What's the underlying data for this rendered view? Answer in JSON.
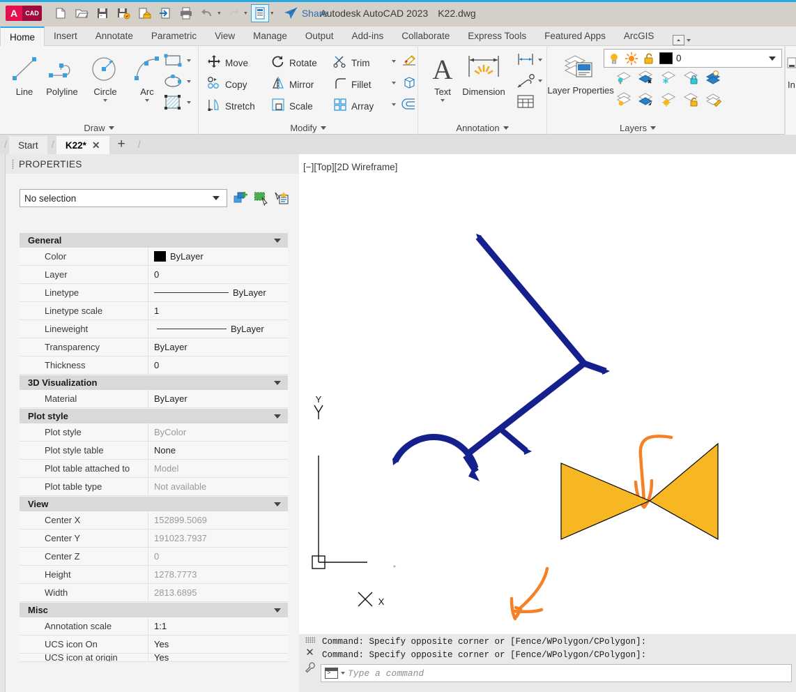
{
  "titlebar": {
    "app_title": "Autodesk AutoCAD 2023",
    "document_title": "K22.dwg",
    "logo_a": "A",
    "logo_cad": "CAD",
    "share_label": "Share",
    "quick_access": [
      {
        "name": "new-icon",
        "tip": "New"
      },
      {
        "name": "open-icon",
        "tip": "Open"
      },
      {
        "name": "save-icon",
        "tip": "Save"
      },
      {
        "name": "saveas-icon",
        "tip": "Save As"
      },
      {
        "name": "save-to-web-icon",
        "tip": "Save to Web & Mobile"
      },
      {
        "name": "open-from-web-icon",
        "tip": "Open from Web & Mobile"
      },
      {
        "name": "plot-icon",
        "tip": "Plot"
      },
      {
        "name": "undo-icon",
        "tip": "Undo"
      },
      {
        "name": "redo-icon",
        "tip": "Redo"
      },
      {
        "name": "workspace-icon",
        "tip": "Workspace"
      }
    ]
  },
  "ribbon": {
    "tabs": [
      {
        "label": "Home",
        "active": true
      },
      {
        "label": "Insert",
        "active": false
      },
      {
        "label": "Annotate",
        "active": false
      },
      {
        "label": "Parametric",
        "active": false
      },
      {
        "label": "View",
        "active": false
      },
      {
        "label": "Manage",
        "active": false
      },
      {
        "label": "Output",
        "active": false
      },
      {
        "label": "Add-ins",
        "active": false
      },
      {
        "label": "Collaborate",
        "active": false
      },
      {
        "label": "Express Tools",
        "active": false
      },
      {
        "label": "Featured Apps",
        "active": false
      },
      {
        "label": "ArcGIS",
        "active": false
      }
    ],
    "panels": {
      "draw": {
        "title": "Draw",
        "buttons": [
          {
            "label": "Line",
            "icon": "line-icon"
          },
          {
            "label": "Polyline",
            "icon": "polyline-icon"
          },
          {
            "label": "Circle",
            "icon": "circle-icon"
          },
          {
            "label": "Arc",
            "icon": "arc-icon"
          }
        ],
        "small_icons": [
          {
            "name": "rectangle-icon"
          },
          {
            "name": "ellipse-icon"
          },
          {
            "name": "hatch-icon"
          }
        ]
      },
      "modify": {
        "title": "Modify",
        "buttons": [
          {
            "label": "Move",
            "icon": "move-icon"
          },
          {
            "label": "Rotate",
            "icon": "rotate-icon"
          },
          {
            "label": "Trim",
            "icon": "trim-icon"
          },
          {
            "label": "Copy",
            "icon": "copy-icon"
          },
          {
            "label": "Mirror",
            "icon": "mirror-icon"
          },
          {
            "label": "Fillet",
            "icon": "fillet-icon"
          },
          {
            "label": "Stretch",
            "icon": "stretch-icon"
          },
          {
            "label": "Scale",
            "icon": "scale-icon"
          },
          {
            "label": "Array",
            "icon": "array-icon"
          }
        ],
        "extra_icons": [
          {
            "name": "erase-icon"
          },
          {
            "name": "explode-icon"
          },
          {
            "name": "offset-icon"
          }
        ]
      },
      "annotation": {
        "title": "Annotation",
        "buttons": [
          {
            "label": "Text",
            "icon": "text-icon"
          },
          {
            "label": "Dimension",
            "icon": "dimension-icon"
          }
        ],
        "small_icons": [
          {
            "name": "linear-dimension-icon"
          },
          {
            "name": "leader-icon"
          },
          {
            "name": "table-icon"
          }
        ]
      },
      "layers": {
        "title": "Layers",
        "main_button": "Layer Properties",
        "layer_combo": {
          "layer_name": "0",
          "color_hex": "#000000",
          "icons": [
            "lightbulb-on-icon",
            "sun-icon",
            "unlock-icon"
          ]
        },
        "tool_icons": [
          {
            "name": "layer-isolate-icon"
          },
          {
            "name": "layer-off-icon"
          },
          {
            "name": "layer-freeze-icon"
          },
          {
            "name": "layer-lock-icon"
          },
          {
            "name": "layer-merge-icon"
          },
          {
            "name": "layer-unisolate-icon"
          },
          {
            "name": "layer-on-icon"
          },
          {
            "name": "layer-thaw-icon"
          },
          {
            "name": "layer-unlock-icon"
          },
          {
            "name": "layer-change-icon"
          }
        ]
      },
      "insert_stub": {
        "label": "In"
      }
    }
  },
  "filetabs": {
    "tabs": [
      {
        "label": "Start",
        "active": false,
        "closable": false
      },
      {
        "label": "K22*",
        "active": true,
        "closable": true
      }
    ],
    "close_glyph": "✕",
    "add_glyph": "+"
  },
  "properties": {
    "panel_title": "PROPERTIES",
    "selection": {
      "value": "No selection",
      "tools": [
        {
          "name": "quick-select-icon"
        },
        {
          "name": "select-objects-icon"
        },
        {
          "name": "quick-properties-icon"
        }
      ]
    },
    "categories": [
      {
        "name": "General",
        "rows": [
          {
            "label": "Color",
            "value": "ByLayer",
            "kind": "color",
            "dim": false
          },
          {
            "label": "Layer",
            "value": "0",
            "kind": "text",
            "dim": false
          },
          {
            "label": "Linetype",
            "value": "ByLayer",
            "kind": "linetype",
            "dim": false
          },
          {
            "label": "Linetype scale",
            "value": "1",
            "kind": "text",
            "dim": false
          },
          {
            "label": "Lineweight",
            "value": "ByLayer",
            "kind": "lineweight",
            "dim": false
          },
          {
            "label": "Transparency",
            "value": "ByLayer",
            "kind": "text",
            "dim": false
          },
          {
            "label": "Thickness",
            "value": "0",
            "kind": "text",
            "dim": false
          }
        ]
      },
      {
        "name": "3D Visualization",
        "rows": [
          {
            "label": "Material",
            "value": "ByLayer",
            "kind": "text",
            "dim": false
          }
        ]
      },
      {
        "name": "Plot style",
        "rows": [
          {
            "label": "Plot style",
            "value": "ByColor",
            "kind": "text",
            "dim": true
          },
          {
            "label": "Plot style table",
            "value": "None",
            "kind": "text",
            "dim": false
          },
          {
            "label": "Plot table attached to",
            "value": "Model",
            "kind": "text",
            "dim": true
          },
          {
            "label": "Plot table type",
            "value": "Not available",
            "kind": "text",
            "dim": true
          }
        ]
      },
      {
        "name": "View",
        "rows": [
          {
            "label": "Center X",
            "value": "152899.5069",
            "kind": "text",
            "dim": true
          },
          {
            "label": "Center Y",
            "value": "191023.7937",
            "kind": "text",
            "dim": true
          },
          {
            "label": "Center Z",
            "value": "0",
            "kind": "text",
            "dim": true
          },
          {
            "label": "Height",
            "value": "1278.7773",
            "kind": "text",
            "dim": true
          },
          {
            "label": "Width",
            "value": "2813.6895",
            "kind": "text",
            "dim": true
          }
        ]
      },
      {
        "name": "Misc",
        "rows": [
          {
            "label": "Annotation scale",
            "value": "1:1",
            "kind": "text",
            "dim": false
          },
          {
            "label": "UCS icon On",
            "value": "Yes",
            "kind": "text",
            "dim": false
          },
          {
            "label": "UCS icon at origin",
            "value": "Yes",
            "kind": "text",
            "dim": false
          }
        ]
      }
    ]
  },
  "canvas": {
    "viewport_label": "[−][Top][2D Wireframe]",
    "ucs": {
      "x_label": "X",
      "y_label": "Y"
    },
    "drawing": {
      "line_color": "#14218c",
      "markup_color": "#f58025",
      "fill_color": "#f7b722",
      "fill_stroke": "#000000",
      "description": "Pipe network schematic with tee branches, an arc bend, a yellow bowtie valve symbol and two orange hand-drawn arrow annotations"
    }
  },
  "command": {
    "history": [
      "Command: Specify opposite corner or [Fence/WPolygon/CPolygon]:",
      "Command: Specify opposite corner or [Fence/WPolygon/CPolygon]:"
    ],
    "input_placeholder": "Type a command",
    "close_glyph": "✕",
    "tools_icon": "wrench-icon"
  },
  "colors": {
    "accent_blue": "#27aae1",
    "titlebar_bg": "#d4d0c8",
    "ribbon_bg": "#f5f5f5",
    "panel_bg": "#f3f3f3",
    "category_bg": "#d9d9d9",
    "share_blue": "#2b6cb0",
    "cad_red": "#e51050"
  }
}
